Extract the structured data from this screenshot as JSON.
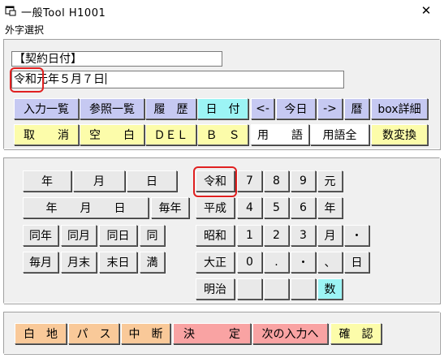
{
  "window": {
    "title": "一般Tool H1001",
    "close_glyph": "✕"
  },
  "menu": {
    "label": "外字選択"
  },
  "fields": {
    "label_value": "【契約日付】",
    "date_value": "令和元年５月７日"
  },
  "toolbar1": [
    "入力一覧",
    "参照一覧",
    "履　歴",
    "日　付",
    "<-",
    "今日",
    "->",
    "暦",
    "box詳細"
  ],
  "toolbar2": [
    "取　　消",
    "空　　白",
    "ＤＥＬ",
    "Ｂ　Ｓ",
    "用　　語",
    "用語全",
    "数変換"
  ],
  "keypad": {
    "row1": [
      "年",
      "月",
      "日"
    ],
    "row2": [
      "年　　月　　日",
      "毎年"
    ],
    "row3": [
      "同年",
      "同月",
      "同日",
      "同"
    ],
    "row4": [
      "毎月",
      "月末",
      "末日",
      "満"
    ],
    "eras": [
      "令和",
      "平成",
      "昭和",
      "大正",
      "明治"
    ],
    "digits": [
      "7",
      "8",
      "9",
      "4",
      "5",
      "6",
      "1",
      "2",
      "3",
      "0",
      ".",
      "・"
    ],
    "symbols": [
      "元",
      "年",
      "月",
      "・",
      "、",
      "日",
      "数"
    ]
  },
  "bottom": [
    "白　地",
    "パ　ス",
    "中　断",
    "決　　　定",
    "次の入力へ",
    "確　認"
  ]
}
